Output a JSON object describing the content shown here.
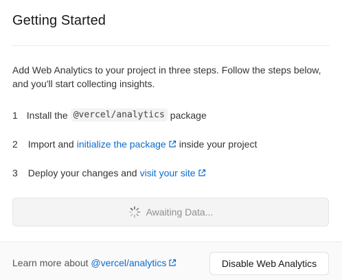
{
  "title": "Getting Started",
  "description": "Add Web Analytics to your project in three steps. Follow the steps below, and you'll start collecting insights.",
  "steps": [
    {
      "number": "1",
      "pre": "Install the",
      "code": "@vercel/analytics",
      "post": "package"
    },
    {
      "number": "2",
      "pre": "Import and",
      "link": "initialize the package",
      "post": "inside your project"
    },
    {
      "number": "3",
      "pre": "Deploy your changes and",
      "link": "visit your site"
    }
  ],
  "status": {
    "label": "Awaiting Data..."
  },
  "footer": {
    "learn_more_prefix": "Learn more about",
    "learn_more_link": "@vercel/analytics",
    "disable_button": "Disable Web Analytics"
  },
  "colors": {
    "link": "#0b6bcb",
    "text": "#171717",
    "muted": "#8f8f8f"
  },
  "icons": {
    "external": "external-link-icon",
    "spinner": "spinner-icon"
  }
}
